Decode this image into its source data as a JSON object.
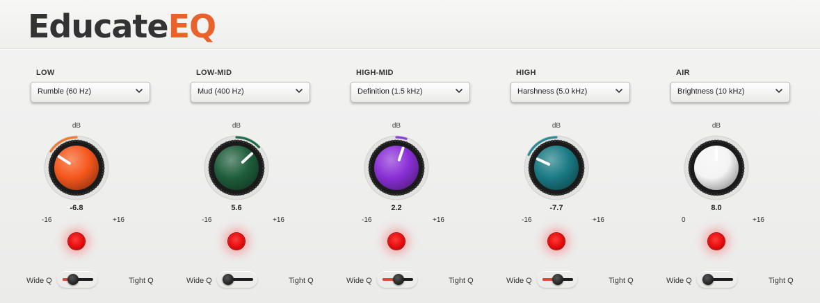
{
  "app": {
    "logo_part1": "Educate",
    "logo_part2": "EQ",
    "accent_color": "#e8632b"
  },
  "db_label": "dB",
  "q_labels": {
    "wide": "Wide Q",
    "tight": "Tight Q"
  },
  "bands": [
    {
      "title": "LOW",
      "preset": "Rumble (60 Hz)",
      "value": -6.8,
      "value_label": "-6.8",
      "min": -16,
      "max": 16,
      "min_label": "-16",
      "max_label": "+16",
      "knob_color": "#f5571c",
      "arc_color": "#f07a30",
      "q": 0.25,
      "q_fill": true
    },
    {
      "title": "LOW-MID",
      "preset": "Mud (400 Hz)",
      "value": 5.6,
      "value_label": "5.6",
      "min": -16,
      "max": 16,
      "min_label": "-16",
      "max_label": "+16",
      "knob_color": "#1f5e3c",
      "arc_color": "#1f6b45",
      "q": 0.0,
      "q_fill": false
    },
    {
      "title": "HIGH-MID",
      "preset": "Definition (1.5 kHz)",
      "value": 2.2,
      "value_label": "2.2",
      "min": -16,
      "max": 16,
      "min_label": "-16",
      "max_label": "+16",
      "knob_color": "#8a2fd6",
      "arc_color": "#8a3ee0",
      "q": 0.55,
      "q_fill": true
    },
    {
      "title": "HIGH",
      "preset": "Harshness (5.0 kHz)",
      "value": -7.7,
      "value_label": "-7.7",
      "min": -16,
      "max": 16,
      "min_label": "-16",
      "max_label": "+16",
      "knob_color": "#1a7a84",
      "arc_color": "#2a8c96",
      "q": 0.5,
      "q_fill": true
    },
    {
      "title": "AIR",
      "preset": "Brightness (10 kHz)",
      "value": 8.0,
      "value_label": "8.0",
      "min": 0,
      "max": 16,
      "min_label": "0",
      "max_label": "+16",
      "knob_color": "#f4f4f4",
      "arc_color": "#e0e0e0",
      "q": 0.0,
      "q_fill": false
    }
  ]
}
